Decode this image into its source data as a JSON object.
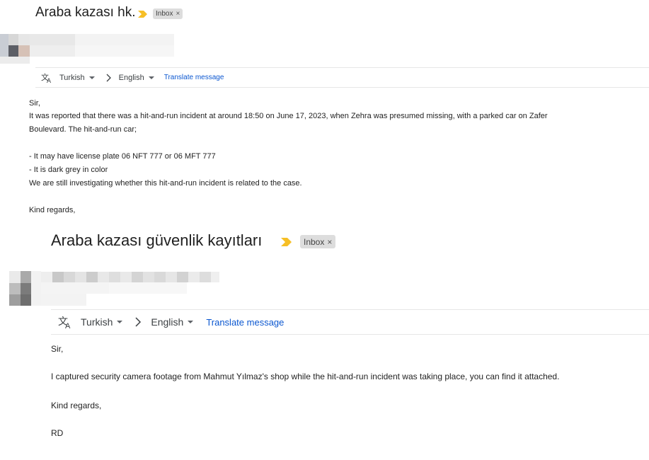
{
  "email1": {
    "subject": "Araba kazası hk.",
    "label": "Inbox",
    "label_close": "×",
    "translate": {
      "from_lang": "Turkish",
      "to_lang": "English",
      "action": "Translate message"
    },
    "body": {
      "greeting": "Sir,",
      "line1": "It was reported that there was a hit-and-run incident at around 18:50 on June 17, 2023, when Zehra was presumed missing, with a parked car on Zafer",
      "line2": "Boulevard. The hit-and-run car;",
      "bullet1": "- It may have license plate 06 NFT 777 or 06 MFT 777",
      "bullet2": "- It is dark grey in color",
      "line3": "We are still investigating whether this hit-and-run incident is related to the case.",
      "closing": "Kind regards,"
    }
  },
  "email2": {
    "subject": "Araba kazası güvenlik kayıtları",
    "label": "Inbox",
    "label_close": "×",
    "translate": {
      "from_lang": "Turkish",
      "to_lang": "English",
      "action": "Translate message"
    },
    "body": {
      "greeting": "Sir,",
      "line1": "I captured security camera footage from Mahmut Yılmaz's shop while the hit-and-run incident was taking place, you can find it attached.",
      "closing": "Kind regards,",
      "signature": "RD"
    }
  },
  "colors": {
    "importance_marker": "#f6bf26",
    "label_bg": "#dddddd",
    "link": "#0b57d0"
  },
  "icons": [
    "importance-marker-icon",
    "translate-icon",
    "chevron-right-icon",
    "caret-down-icon"
  ]
}
